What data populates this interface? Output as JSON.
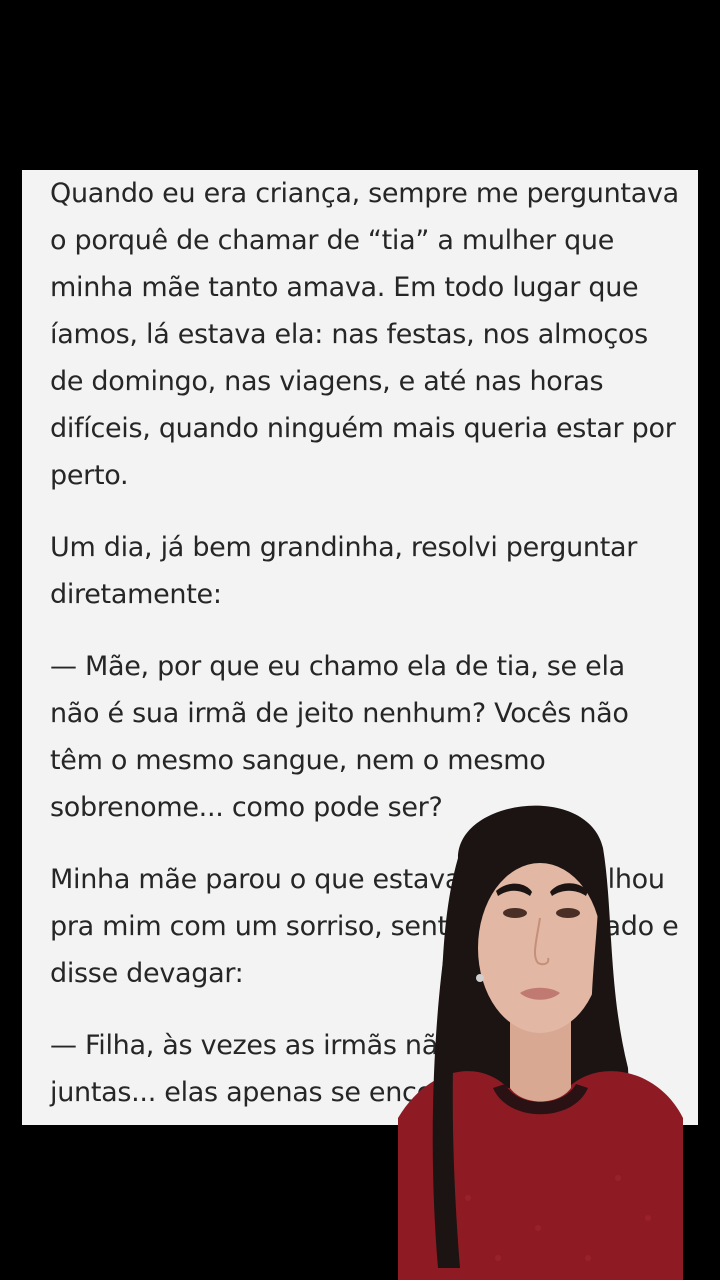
{
  "article": {
    "paragraphs": [
      "Quando eu era criança, sempre me perguntava o porquê de chamar de “tia” a mulher que minha mãe tanto amava. Em todo lugar que íamos, lá estava ela: nas festas, nos almoços de domingo, nas viagens, e até nas horas difíceis, quando ninguém mais queria estar por perto.",
      "Um dia, já bem grandinha, resolvi perguntar diretamente:",
      "— Mãe, por que eu chamo ela de tia, se ela não é sua irmã de jeito nenhum? Vocês não têm o mesmo sangue, nem o mesmo sobrenome... como pode ser?",
      "Minha mãe parou o que estava fazendo, olhou pra mim com um sorriso, sentou ao meu lado e disse devagar:",
      "— Filha, às vezes as irmãs não nascem juntas... elas apenas se encontram."
    ]
  },
  "overlay": {
    "subject": "woman-speaking-to-camera",
    "sweater_color": "#8e1b24",
    "hair_color": "#1b1412",
    "skin_color": "#e2b7a3"
  }
}
